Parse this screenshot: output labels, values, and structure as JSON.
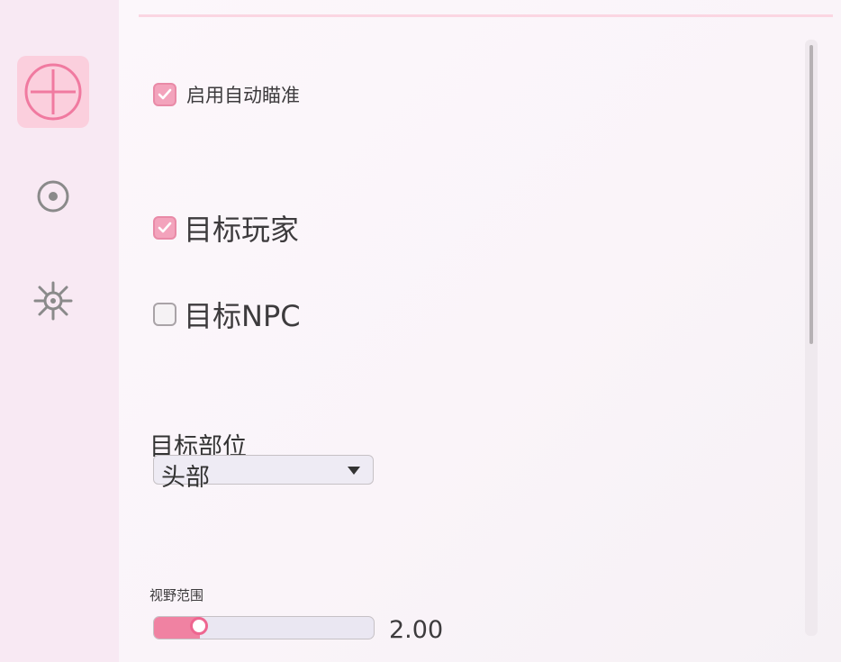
{
  "sidebar": {
    "items": [
      {
        "icon": "crosshair-icon",
        "active": true
      },
      {
        "icon": "target-dot-icon",
        "active": false
      },
      {
        "icon": "burst-icon",
        "active": false
      }
    ]
  },
  "aim": {
    "enable_label": "启用自动瞄准",
    "enable_checked": true,
    "target_player_label": "目标玩家",
    "target_player_checked": true,
    "target_npc_label": "目标NPC",
    "target_npc_checked": false,
    "target_part_label": "目标部位",
    "target_part_value": "头部",
    "fov_label": "视野范围",
    "fov_value": "2.00",
    "fov_fraction": 0.15
  },
  "colors": {
    "accent": "#f082a2",
    "accent_active_bg": "#fbcfdd",
    "sidebar_bg": "#f8e9f3",
    "icon_gray": "#8a8a8a"
  }
}
